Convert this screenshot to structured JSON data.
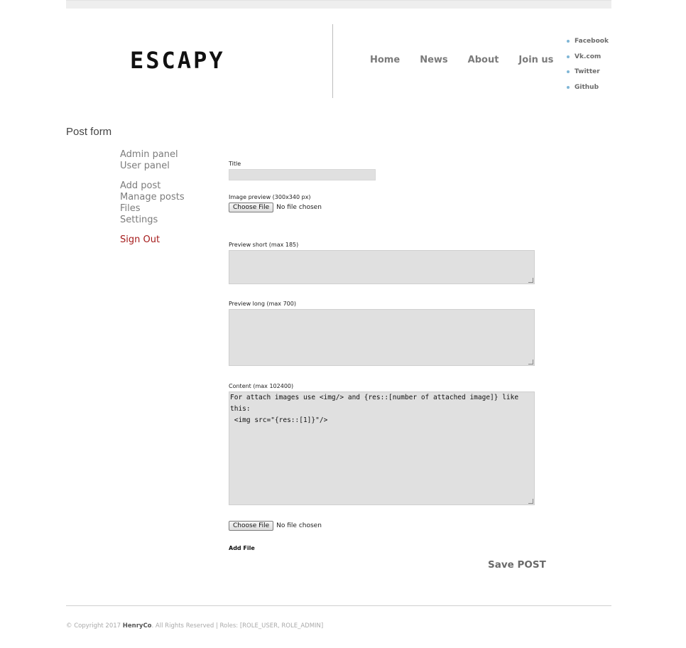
{
  "header": {
    "logo": "ESCAPY",
    "nav": [
      "Home",
      "News",
      "About",
      "Join us"
    ],
    "social": [
      "Facebook",
      "Vk.com",
      "Twitter",
      "Github"
    ]
  },
  "page": {
    "title": "Post form"
  },
  "sidebar": {
    "group1": [
      "Admin panel",
      "User panel"
    ],
    "group2": [
      "Add post",
      "Manage posts",
      "Files",
      "Settings"
    ],
    "sign_out": "Sign Out"
  },
  "form": {
    "title_label": "Title",
    "title_value": "",
    "image_label": "Image preview (300x340 px)",
    "choose_file": "Choose File",
    "no_file": "No file chosen",
    "preview_short_label": "Preview short (max 185)",
    "preview_short_value": "",
    "preview_long_label": "Preview long (max 700)",
    "preview_long_value": "",
    "content_label": "Content (max 102400)",
    "content_value": "For attach images use <img/> and {res::[number of attached image]} like this:\n <img src=\"{res::[1]}\"/>",
    "add_file": "Add File",
    "save": "Save POST"
  },
  "footer": {
    "copyright_prefix": "© Copyright 2017",
    "brand": "HenryCo",
    "copyright_suffix": ". All Rights Reserved | Roles: [ROLE_USER, ROLE_ADMIN]"
  }
}
